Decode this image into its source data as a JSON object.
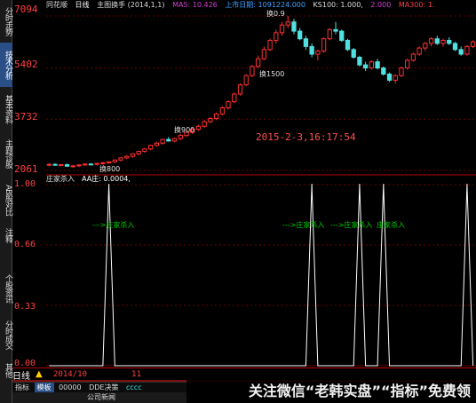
{
  "header": {
    "app_name": "同花顺",
    "period_tab": "日线",
    "indicator_label": "主图换手 (2014,1,1)",
    "ma5": "MA5: 10.426",
    "stock_day": "上市日期: 1091224.000",
    "ks100": "KS100: 1.000,",
    "ma300": "MA300: 1.",
    "num1": "2.000"
  },
  "y_axis_main": [
    "7094",
    "5402",
    "3732",
    "2061"
  ],
  "y_axis_ind": [
    "1.00",
    "0.66",
    "0.33",
    "0.00"
  ],
  "left_tabs": [
    "分时走势",
    "技术分析",
    "基本资料",
    "主题诊股",
    "AB股对比",
    "注释",
    "个股资讯",
    "分时成交",
    "其他"
  ],
  "annotations": [
    {
      "text": "换800"
    },
    {
      "text": "换900"
    },
    {
      "text": "换1500"
    },
    {
      "text": "换0.9"
    }
  ],
  "timestamp": "2015-2-3,16:17:54",
  "indicator": {
    "name": "庄家杀入",
    "value_label": "AA庄: 0.0004,"
  },
  "signals": [
    "--->庄家杀入",
    "--->庄家杀入",
    "--->庄家杀入",
    "庄家杀入"
  ],
  "xaxis": {
    "period": "日线",
    "date1": "2014/10",
    "date2": "11"
  },
  "toolbar": [
    "指标",
    "模板",
    "00000",
    "DDE决策",
    "cccc"
  ],
  "status": "公司新闻",
  "watermark": "关注微信“老韩实盘”“指标”免费领",
  "colors": {
    "up": "#ff3030",
    "down": "#50e0e0",
    "grid": "#6a0000",
    "signal": "#00d000"
  },
  "chart_data": {
    "type": "candlestick",
    "ylim": [
      2061,
      7094
    ],
    "ohlc": [
      [
        2250,
        2300,
        2200,
        2260
      ],
      [
        2260,
        2290,
        2210,
        2230
      ],
      [
        2230,
        2270,
        2190,
        2250
      ],
      [
        2250,
        2280,
        2180,
        2200
      ],
      [
        2200,
        2240,
        2150,
        2210
      ],
      [
        2210,
        2260,
        2170,
        2240
      ],
      [
        2240,
        2290,
        2210,
        2270
      ],
      [
        2270,
        2300,
        2230,
        2260
      ],
      [
        2260,
        2310,
        2220,
        2290
      ],
      [
        2290,
        2340,
        2250,
        2310
      ],
      [
        2310,
        2360,
        2280,
        2340
      ],
      [
        2340,
        2420,
        2300,
        2400
      ],
      [
        2400,
        2500,
        2360,
        2470
      ],
      [
        2470,
        2560,
        2430,
        2520
      ],
      [
        2520,
        2620,
        2480,
        2600
      ],
      [
        2600,
        2700,
        2550,
        2680
      ],
      [
        2680,
        2790,
        2640,
        2760
      ],
      [
        2760,
        2900,
        2720,
        2880
      ],
      [
        2880,
        3000,
        2840,
        2950
      ],
      [
        2950,
        3100,
        2900,
        3070
      ],
      [
        3070,
        3150,
        3000,
        3020
      ],
      [
        3020,
        3130,
        2980,
        3100
      ],
      [
        3100,
        3250,
        3050,
        3200
      ],
      [
        3200,
        3350,
        3150,
        3300
      ],
      [
        3300,
        3450,
        3250,
        3400
      ],
      [
        3400,
        3550,
        3350,
        3500
      ],
      [
        3500,
        3700,
        3450,
        3650
      ],
      [
        3650,
        3800,
        3600,
        3750
      ],
      [
        3750,
        3950,
        3700,
        3900
      ],
      [
        3900,
        4150,
        3850,
        4100
      ],
      [
        4100,
        4350,
        4050,
        4300
      ],
      [
        4300,
        4600,
        4250,
        4550
      ],
      [
        4550,
        4900,
        4500,
        4850
      ],
      [
        4850,
        5200,
        4800,
        5150
      ],
      [
        5150,
        5500,
        5100,
        5450
      ],
      [
        5450,
        5800,
        5400,
        5700
      ],
      [
        5700,
        6100,
        5650,
        6000
      ],
      [
        6000,
        6350,
        5950,
        6300
      ],
      [
        6300,
        6650,
        6200,
        6550
      ],
      [
        6550,
        6900,
        6450,
        6800
      ],
      [
        6800,
        7094,
        6700,
        6900
      ],
      [
        6900,
        7000,
        6500,
        6600
      ],
      [
        6600,
        6700,
        6300,
        6350
      ],
      [
        6350,
        6450,
        6000,
        6100
      ],
      [
        6100,
        6200,
        5750,
        5850
      ],
      [
        5850,
        6000,
        5650,
        5950
      ],
      [
        5950,
        6400,
        5900,
        6350
      ],
      [
        6350,
        6700,
        6300,
        6650
      ],
      [
        6650,
        6900,
        6500,
        6600
      ],
      [
        6600,
        6650,
        6250,
        6300
      ],
      [
        6300,
        6350,
        5950,
        6000
      ],
      [
        6000,
        6050,
        5700,
        5750
      ],
      [
        5750,
        5800,
        5450,
        5500
      ],
      [
        5500,
        5600,
        5300,
        5400
      ],
      [
        5400,
        5650,
        5350,
        5600
      ],
      [
        5600,
        5700,
        5350,
        5400
      ],
      [
        5400,
        5450,
        5150,
        5200
      ],
      [
        5200,
        5250,
        4950,
        5000
      ],
      [
        5000,
        5200,
        4900,
        5150
      ],
      [
        5150,
        5450,
        5100,
        5400
      ],
      [
        5400,
        5700,
        5350,
        5650
      ],
      [
        5650,
        5900,
        5600,
        5850
      ],
      [
        5850,
        6100,
        5800,
        6050
      ],
      [
        6050,
        6250,
        5950,
        6200
      ],
      [
        6200,
        6400,
        6100,
        6350
      ],
      [
        6350,
        6450,
        6150,
        6200
      ],
      [
        6200,
        6350,
        6100,
        6300
      ],
      [
        6300,
        6400,
        6150,
        6200
      ],
      [
        6200,
        6250,
        5950,
        6000
      ],
      [
        6000,
        6100,
        5800,
        5850
      ],
      [
        5850,
        6150,
        5800,
        6100
      ],
      [
        6100,
        6300,
        6050,
        6250
      ]
    ],
    "indicator_series": {
      "name": "AA庄",
      "spikes_at": [
        10,
        44,
        52,
        56,
        70
      ],
      "ylim": [
        0,
        1
      ]
    }
  }
}
